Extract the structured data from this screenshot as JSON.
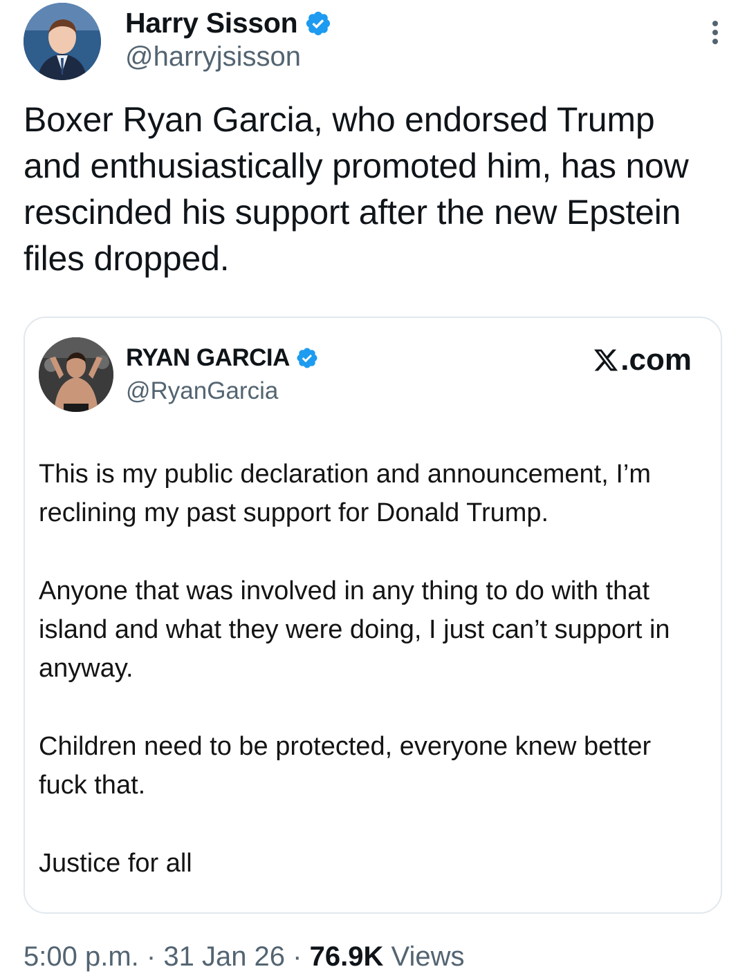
{
  "author": {
    "display_name": "Harry Sisson",
    "handle": "@harryjsisson"
  },
  "tweet": {
    "text": "Boxer Ryan Garcia, who endorsed Trump and enthusiastically promoted him, has now rescinded his support after the new Epstein files dropped."
  },
  "quoted": {
    "display_name": "RYAN GARCIA",
    "handle": "@RyanGarcia",
    "source": ".com",
    "paragraphs": [
      "This is my public declaration and announcement, I’m reclining my past support for Donald Trump.",
      "Anyone that was involved in any thing to do with that island and what they were doing, I just can’t support in anyway.",
      "Children need to be protected, everyone knew better fuck that.",
      "Justice for all"
    ]
  },
  "meta": {
    "time": "5:00 p.m.",
    "separator": "·",
    "date": "31 Jan 26",
    "views_count": "76.9K",
    "views_label": "Views"
  },
  "colors": {
    "verified": "#1d9bf0",
    "secondary_text": "#536471",
    "border": "#e1e8ed"
  }
}
